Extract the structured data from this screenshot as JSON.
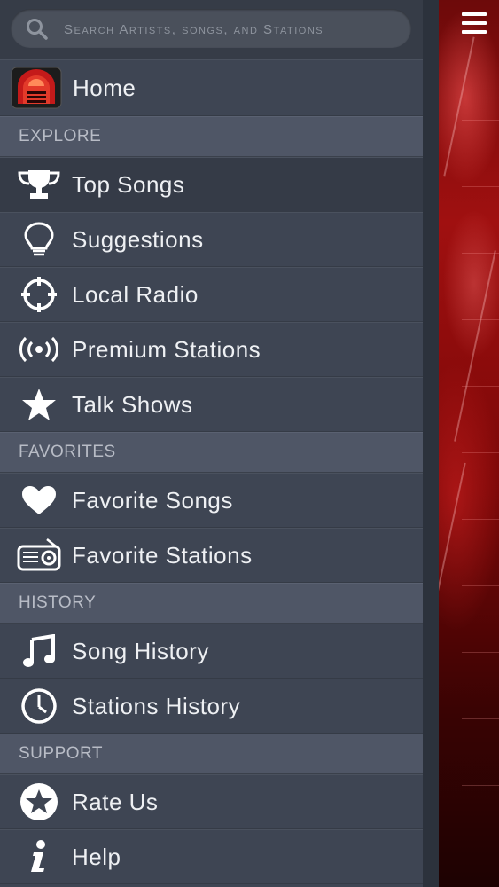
{
  "search": {
    "placeholder": "Search Artists, songs, and Stations"
  },
  "home": {
    "label": "Home",
    "icon": "jukebox-logo-icon"
  },
  "sections": {
    "explore": "EXPLORE",
    "favorites": "FAVORITES",
    "history": "HISTORY",
    "support": "SUPPORT"
  },
  "explore_items": [
    {
      "label": "Top Songs",
      "icon": "trophy-icon",
      "selected": true
    },
    {
      "label": "Suggestions",
      "icon": "lightbulb-icon"
    },
    {
      "label": "Local Radio",
      "icon": "crosshair-icon"
    },
    {
      "label": "Premium Stations",
      "icon": "broadcast-icon"
    },
    {
      "label": "Talk Shows",
      "icon": "star-icon"
    }
  ],
  "favorites_items": [
    {
      "label": "Favorite Songs",
      "icon": "heart-icon"
    },
    {
      "label": "Favorite Stations",
      "icon": "radio-icon"
    }
  ],
  "history_items": [
    {
      "label": "Song History",
      "icon": "music-note-icon"
    },
    {
      "label": "Stations History",
      "icon": "clock-icon"
    }
  ],
  "support_items": [
    {
      "label": "Rate Us",
      "icon": "star-badge-icon"
    },
    {
      "label": "Help",
      "icon": "info-icon"
    }
  ],
  "colors": {
    "drawer_bg": "#3e4553",
    "section_bg": "#4f5666",
    "accent_red": "#a01010"
  }
}
